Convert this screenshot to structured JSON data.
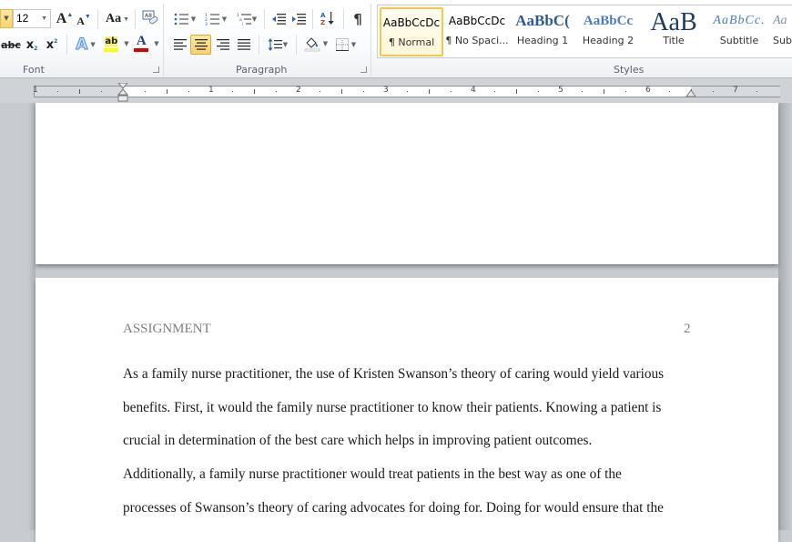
{
  "ribbon": {
    "font_group": {
      "label": "Font",
      "font_size": "12",
      "grow_font": "A",
      "shrink_font": "A",
      "change_case": "Aa",
      "strikethrough": "abc",
      "subscript": "x",
      "superscript": "x",
      "text_effects": "A",
      "highlight": "ab",
      "font_color": "A",
      "highlight_color": "#ffff00",
      "font_color_value": "#e00000"
    },
    "paragraph_group": {
      "label": "Paragraph",
      "sort": "A Z",
      "show_marks": "¶",
      "active_alignment": "center"
    },
    "styles_group": {
      "label": "Styles",
      "items": [
        {
          "sample": "AaBbCcDc",
          "name": "¶ Normal",
          "selected": true
        },
        {
          "sample": "AaBbCcDc",
          "name": "¶ No Spaci...",
          "selected": false
        },
        {
          "sample": "AaBbC(",
          "name": "Heading 1",
          "selected": false
        },
        {
          "sample": "AaBbCc",
          "name": "Heading 2",
          "selected": false
        },
        {
          "sample": "AaB",
          "name": "Title",
          "selected": false
        },
        {
          "sample": "AaBbCc.",
          "name": "Subtitle",
          "selected": false
        },
        {
          "sample": "Aa",
          "name": "Sub",
          "selected": false
        }
      ]
    }
  },
  "ruler": {
    "numbers": [
      "1",
      "1",
      "2",
      "3",
      "4",
      "5",
      "6",
      "7"
    ]
  },
  "document": {
    "page2": {
      "header_left": "ASSIGNMENT",
      "header_right": "2",
      "lines": [
        "As a family nurse practitioner, the use of Kristen Swanson’s theory of caring would yield various",
        "benefits. First, it would the family nurse practitioner to know their patients. Knowing a patient is",
        "crucial in determination of the best care which helps in improving patient outcomes.",
        "Additionally, a family nurse practitioner would treat patients in the best way as one of the",
        "processes of Swanson’s theory of caring advocates for doing for. Doing for would ensure that the"
      ]
    }
  }
}
